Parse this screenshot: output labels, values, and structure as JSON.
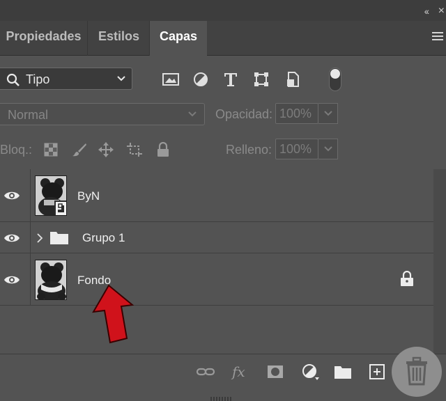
{
  "tabs": [
    {
      "label": "Propiedades",
      "active": false
    },
    {
      "label": "Estilos",
      "active": false
    },
    {
      "label": "Capas",
      "active": true
    }
  ],
  "window_controls": {
    "collapse": "‹‹",
    "close": "×"
  },
  "filter": {
    "kind_label": "Tipo",
    "icons": [
      "image-filter-icon",
      "adjustment-filter-icon",
      "type-filter-icon",
      "shape-filter-icon",
      "smart-object-filter-icon"
    ],
    "filter_toggle_on": true
  },
  "blending": {
    "mode": "Normal",
    "opacity_label": "Opacidad:",
    "opacity_value": "100%"
  },
  "locks": {
    "label": "Bloq.:",
    "fill_label": "Relleno:",
    "fill_value": "100%",
    "icons": [
      "lock-transparent-icon",
      "lock-image-icon",
      "lock-position-icon",
      "lock-artboard-icon",
      "lock-all-icon"
    ]
  },
  "layers": [
    {
      "name": "ByN",
      "type": "smart-object",
      "visible": true,
      "locked": false
    },
    {
      "name": "Grupo 1",
      "type": "group",
      "visible": true,
      "locked": false
    },
    {
      "name": "Fondo",
      "type": "background",
      "visible": true,
      "locked": true
    }
  ],
  "bottom_actions": [
    "link-layers-icon",
    "fx-icon",
    "layer-mask-icon",
    "adjustment-layer-icon",
    "new-group-icon",
    "new-layer-icon",
    "trash-icon"
  ],
  "colors": {
    "panel": "#535353",
    "tab_bar": "#424242",
    "annotation_arrow": "#d0121b"
  }
}
